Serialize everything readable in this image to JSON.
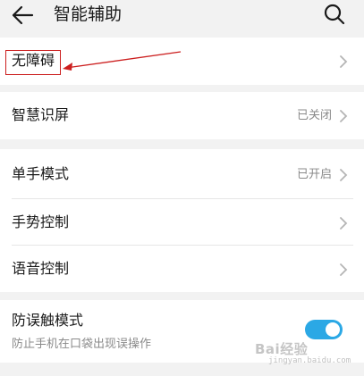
{
  "header": {
    "title": "智能辅助",
    "back_icon": "arrow-left-icon",
    "search_icon": "search-icon"
  },
  "sections": {
    "accessibility": {
      "label": "无障碍"
    },
    "smart_screen": {
      "label": "智慧识屏",
      "status": "已关闭"
    },
    "one_hand": {
      "label": "单手模式",
      "status": "已开启"
    },
    "gesture": {
      "label": "手势控制"
    },
    "voice": {
      "label": "语音控制"
    },
    "anti_mistouch": {
      "label": "防误触模式",
      "sublabel": "防止手机在口袋出现误操作",
      "enabled": true
    }
  },
  "annotation": {
    "color": "#cc1f1f"
  },
  "colors": {
    "toggle_on": "#2ba8e5",
    "background": "#f2f2f2"
  },
  "watermark": {
    "text": "Bai经验",
    "sub": "jingyan.baidu.com"
  }
}
